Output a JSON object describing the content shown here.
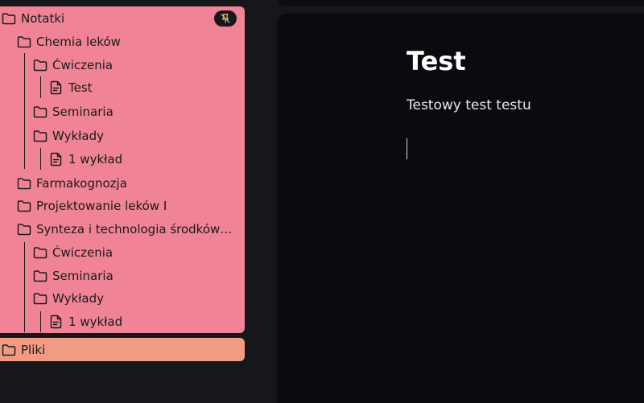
{
  "sidebar": {
    "root": {
      "label": "Notatki",
      "icon": "folder-icon"
    },
    "pin_badge_icon": "pin-off-icon",
    "tree": [
      {
        "label": "Chemia leków",
        "icon": "folder-icon"
      },
      {
        "label": "Ćwiczenia",
        "icon": "folder-icon"
      },
      {
        "label": "Test",
        "icon": "document-icon"
      },
      {
        "label": "Seminaria",
        "icon": "folder-icon"
      },
      {
        "label": "Wykłady",
        "icon": "folder-icon"
      },
      {
        "label": "1 wykład",
        "icon": "document-icon"
      },
      {
        "label": "Farmakognozja",
        "icon": "folder-icon"
      },
      {
        "label": "Projektowanie leków I",
        "icon": "folder-icon"
      },
      {
        "label": "Synteza i technologia środków lec...",
        "icon": "folder-icon"
      },
      {
        "label": "Ćwiczenia",
        "icon": "folder-icon"
      },
      {
        "label": "Seminaria",
        "icon": "folder-icon"
      },
      {
        "label": "Wykłady",
        "icon": "folder-icon"
      },
      {
        "label": "1 wykład",
        "icon": "document-icon"
      }
    ],
    "files": {
      "label": "Pliki",
      "icon": "folder-icon"
    }
  },
  "editor": {
    "title": "Test",
    "body": "Testowy test testu"
  },
  "colors": {
    "tree_panel": "#f08496",
    "files_panel": "#f29b84",
    "editor_bg": "#0a0b0e",
    "app_bg": "#16171b"
  }
}
